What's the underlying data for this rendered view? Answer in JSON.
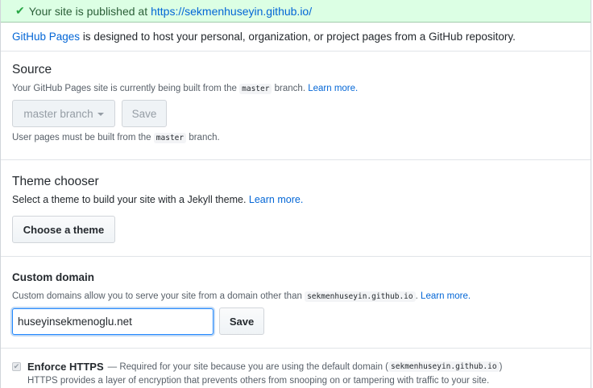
{
  "flash": {
    "message": "Your site is published at",
    "url": "https://sekmenhuseyin.github.io/"
  },
  "intro": {
    "link": "GitHub Pages",
    "text": "is designed to host your personal, organization, or project pages from a GitHub repository."
  },
  "source": {
    "title": "Source",
    "desc_before": "Your GitHub Pages site is currently being built from the",
    "desc_code": "master",
    "desc_after": "branch.",
    "learn_more": "Learn more.",
    "branch_select": "master branch",
    "save": "Save",
    "note_before": "User pages must be built from the",
    "note_code": "master",
    "note_after": "branch."
  },
  "theme": {
    "title": "Theme chooser",
    "desc": "Select a theme to build your site with a Jekyll theme.",
    "learn_more": "Learn more.",
    "button": "Choose a theme"
  },
  "custom_domain": {
    "title": "Custom domain",
    "desc_before": "Custom domains allow you to serve your site from a domain other than",
    "desc_code": "sekmenhuseyin.github.io",
    "desc_after": ".",
    "learn_more": "Learn more.",
    "input_value": "huseyinsekmenoglu.net",
    "save": "Save"
  },
  "https": {
    "label": "Enforce HTTPS",
    "desc_before": "— Required for your site because you are using the default domain (",
    "desc_code": "sekmenhuseyin.github.io",
    "desc_after": ")",
    "desc2": "HTTPS provides a layer of encryption that prevents others from snooping on or tampering with traffic to your site."
  }
}
